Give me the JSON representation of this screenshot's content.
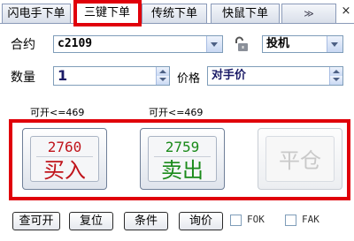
{
  "tabs": [
    {
      "label": "闪电手下单",
      "active": false
    },
    {
      "label": "三键下单",
      "active": true
    },
    {
      "label": "传统下单",
      "active": false
    },
    {
      "label": "快鼠下单",
      "active": false
    }
  ],
  "tab_more_glyph": "≫",
  "tab_close_glyph": "×",
  "form": {
    "contract_label": "合约",
    "contract_value": "c2109",
    "hedge_value": "投机",
    "quantity_label": "数量",
    "quantity_value": "1",
    "price_label": "价格",
    "price_value": "对手价"
  },
  "hints": {
    "buy_available": "可开<=469",
    "sell_available": "可开<=469"
  },
  "actions": {
    "buy": {
      "price": "2760",
      "label": "买入",
      "color": "#c0141b"
    },
    "sell": {
      "price": "2759",
      "label": "卖出",
      "color": "#1a8a1a"
    },
    "close": {
      "label": "平仓",
      "color": "#c9c9c9"
    }
  },
  "bottom": {
    "query_label": "查可开",
    "reset_label": "复位",
    "condition_label": "条件",
    "inquiry_label": "询价",
    "fok_label": "FOK",
    "fak_label": "FAK"
  },
  "colors": {
    "highlight_box": "#e0000a",
    "accent": "#4d6185"
  },
  "icons": {
    "lock": "unlocked-padlock-icon",
    "more": "double-chevron-down-icon",
    "close": "close-icon"
  }
}
